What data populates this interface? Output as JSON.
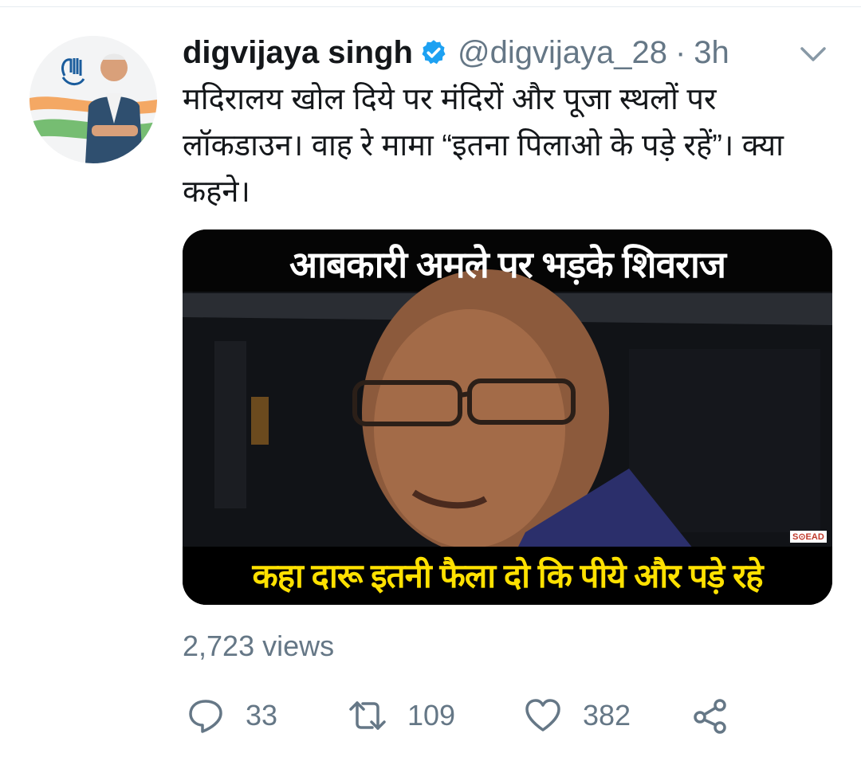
{
  "tweet": {
    "author_name": "digvijaya singh",
    "handle": "@digvijaya_28",
    "separator": "·",
    "time": "3h",
    "text": "मदिरालय खोल दिये पर मंदिरों और पूजा स्थलों पर लॉकडाउन। वाह रे मामा “इतना पिलाओ के पड़े रहें”। क्या कहने।",
    "media": {
      "headline": "आबकारी अमले पर भड़के शिवराज",
      "caption": "कहा दारू इतनी फैला दो कि पीये और पड़े रहे",
      "watermark": "S⊙EAD"
    },
    "views": "2,723 views",
    "actions": {
      "replies": "33",
      "retweets": "109",
      "likes": "382"
    }
  },
  "icons": {
    "verified": "verified-badge-icon",
    "caret": "chevron-down-icon",
    "reply": "reply-icon",
    "retweet": "retweet-icon",
    "like": "heart-icon",
    "share": "share-icon"
  },
  "colors": {
    "text_primary": "#14171a",
    "text_secondary": "#657786",
    "verified_blue": "#1da1f2",
    "caption_yellow": "#ffe100"
  }
}
